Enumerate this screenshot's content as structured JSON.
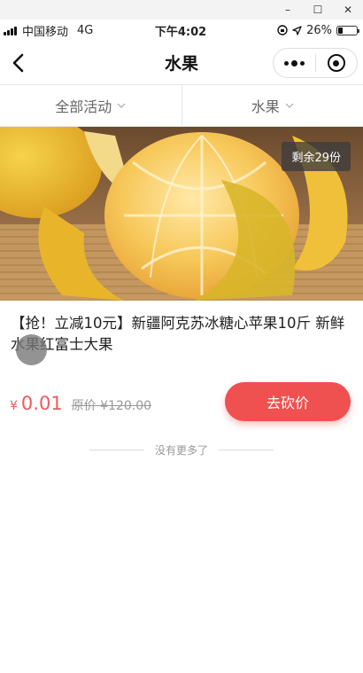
{
  "window_controls": {
    "minimize": "–",
    "maximize": "☐",
    "close": "✕"
  },
  "status_bar": {
    "carrier": "中国移动",
    "network": "4G",
    "time": "下午4:02",
    "battery": "26%",
    "battery_level": 0.26
  },
  "nav": {
    "title": "水果"
  },
  "filters": [
    {
      "label": "全部活动"
    },
    {
      "label": "水果"
    }
  ],
  "product": {
    "stock": "剩余29份",
    "title": "【抢！立减10元】新疆阿克苏冰糖心苹果10斤 新鲜水果红富士大果",
    "currency": "¥",
    "price": "0.01",
    "original_price": "原价 ¥120.00",
    "action": "去砍价"
  },
  "footer": {
    "no_more": "没有更多了"
  },
  "colors": {
    "accent": "#ef5050",
    "price": "#f05a5a"
  }
}
